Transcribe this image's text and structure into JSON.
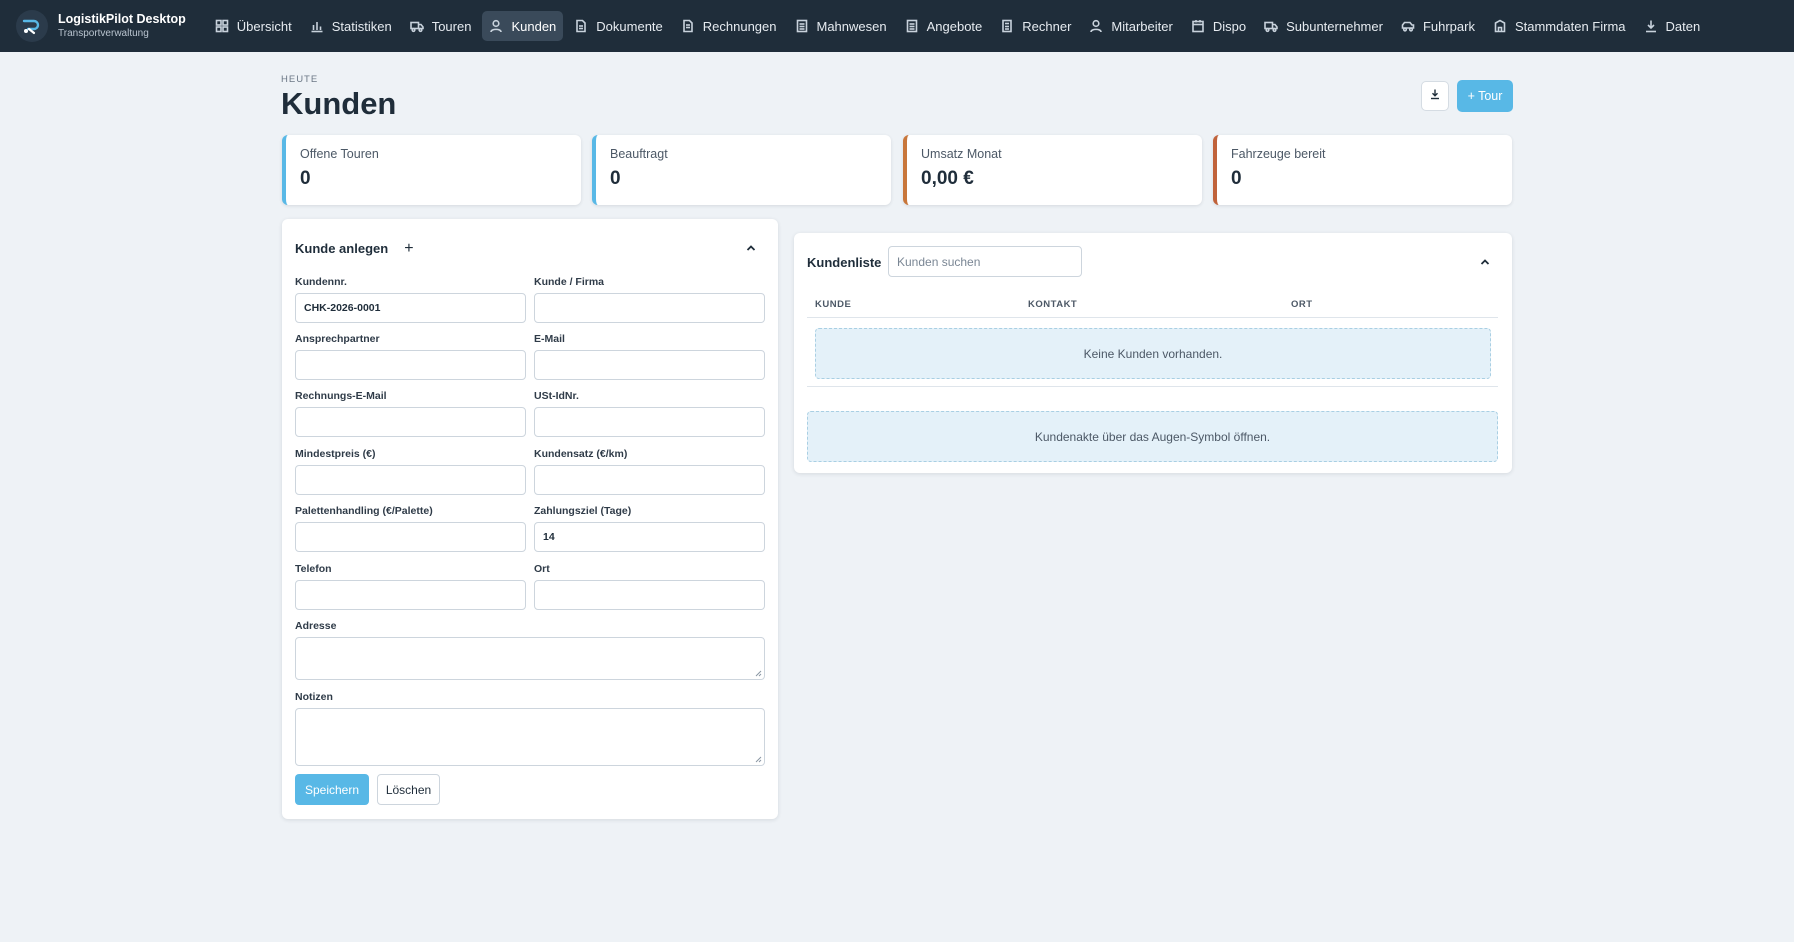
{
  "app": {
    "title": "LogistikPilot Desktop",
    "subtitle": "Transportverwaltung"
  },
  "nav": [
    {
      "label": "Übersicht",
      "icon": "dashboard-icon"
    },
    {
      "label": "Statistiken",
      "icon": "bar-chart-icon"
    },
    {
      "label": "Touren",
      "icon": "truck-icon"
    },
    {
      "label": "Kunden",
      "icon": "user-icon",
      "active": true
    },
    {
      "label": "Dokumente",
      "icon": "document-icon"
    },
    {
      "label": "Rechnungen",
      "icon": "invoice-icon"
    },
    {
      "label": "Mahnwesen",
      "icon": "reminder-icon"
    },
    {
      "label": "Angebote",
      "icon": "offer-icon"
    },
    {
      "label": "Rechner",
      "icon": "calculator-icon"
    },
    {
      "label": "Mitarbeiter",
      "icon": "employee-icon"
    },
    {
      "label": "Dispo",
      "icon": "calendar-icon"
    },
    {
      "label": "Subunternehmer",
      "icon": "subcontractor-icon"
    },
    {
      "label": "Fuhrpark",
      "icon": "fleet-icon"
    },
    {
      "label": "Stammdaten Firma",
      "icon": "building-icon"
    },
    {
      "label": "Daten",
      "icon": "download-icon"
    }
  ],
  "header": {
    "eyebrow": "HEUTE",
    "title": "Kunden",
    "tour_button": "+ Tour"
  },
  "stats": [
    {
      "label": "Offene Touren",
      "value": "0",
      "color": "#58b8e6"
    },
    {
      "label": "Beauftragt",
      "value": "0",
      "color": "#58b8e6"
    },
    {
      "label": "Umsatz Monat",
      "value": "0,00 €",
      "color": "#c8763a"
    },
    {
      "label": "Fahrzeuge bereit",
      "value": "0",
      "color": "#c0623a"
    }
  ],
  "form": {
    "title": "Kunde anlegen",
    "fields": {
      "kundennr": {
        "label": "Kundennr.",
        "value": "CHK-2026-0001"
      },
      "firma": {
        "label": "Kunde / Firma",
        "value": ""
      },
      "ansprechpartner": {
        "label": "Ansprechpartner",
        "value": ""
      },
      "email": {
        "label": "E-Mail",
        "value": ""
      },
      "rechnungs_email": {
        "label": "Rechnungs-E-Mail",
        "value": ""
      },
      "ust": {
        "label": "USt-IdNr.",
        "value": ""
      },
      "mindestpreis": {
        "label": "Mindestpreis (€)",
        "value": ""
      },
      "kundensatz": {
        "label": "Kundensatz (€/km)",
        "value": ""
      },
      "palettenhandling": {
        "label": "Palettenhandling (€/Palette)",
        "value": ""
      },
      "zahlungsziel": {
        "label": "Zahlungsziel (Tage)",
        "value": "14"
      },
      "telefon": {
        "label": "Telefon",
        "value": ""
      },
      "ort": {
        "label": "Ort",
        "value": ""
      },
      "adresse": {
        "label": "Adresse",
        "value": ""
      },
      "notizen": {
        "label": "Notizen",
        "value": ""
      }
    },
    "save_label": "Speichern",
    "delete_label": "Löschen"
  },
  "list": {
    "title": "Kundenliste",
    "search_placeholder": "Kunden suchen",
    "columns": [
      "KUNDE",
      "KONTAKT",
      "ORT"
    ],
    "empty_text": "Keine Kunden vorhanden.",
    "hint_text": "Kundenakte über das Augen-Symbol öffnen."
  },
  "colors": {
    "accent": "#58b8e6",
    "navbar": "#1f2d3a",
    "background": "#eef2f6"
  }
}
